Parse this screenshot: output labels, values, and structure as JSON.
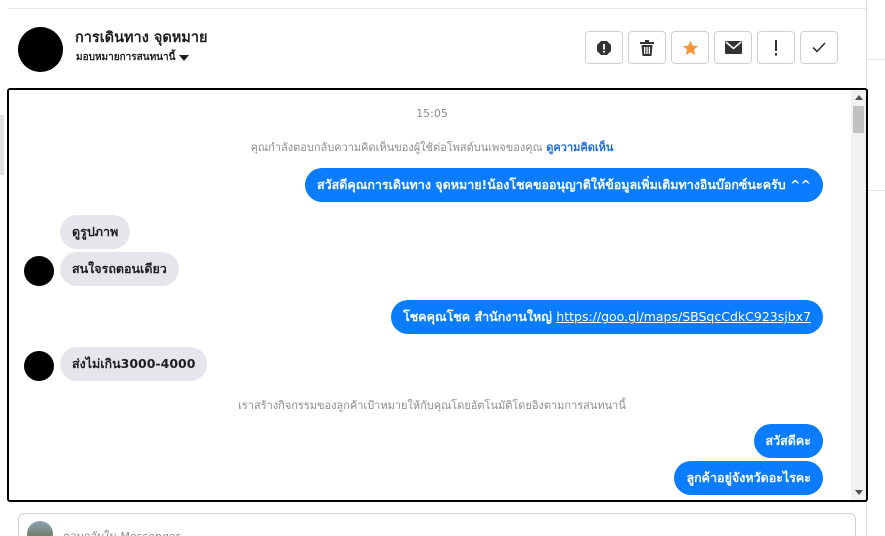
{
  "header": {
    "title": "การเดินทาง จุดหมาย",
    "assign_label": "มอบหมายการสนทนานี้",
    "toolbar": [
      {
        "name": "spam-button",
        "icon": "alert-icon"
      },
      {
        "name": "delete-button",
        "icon": "trash-icon"
      },
      {
        "name": "follow-up-button",
        "icon": "star-icon"
      },
      {
        "name": "mark-unread-button",
        "icon": "envelope-icon"
      },
      {
        "name": "important-button",
        "icon": "exclamation-icon"
      },
      {
        "name": "done-button",
        "icon": "check-icon"
      }
    ]
  },
  "conversation": {
    "timestamp": "15:05",
    "reply_note": "คุณกำลังตอบกลับความคิดเห็นของผู้ใช้ต่อโพสต์บนเพจของคุณ",
    "reply_note_link": "ดูความคิดเห็น",
    "messages": [
      {
        "side": "out",
        "text": "สวัสดีคุณการเดินทาง จุดหมาย!น้องโชคขออนุญาติให้ข้อมูลเพิ่มเติมทางอินบ๊อกซ์นะครับ ^^"
      },
      {
        "side": "in",
        "text": "ดูรูปภาพ"
      },
      {
        "side": "in",
        "text": "สนใจรถตอนเดียว"
      },
      {
        "side": "out",
        "text_prefix": "โชคคุณโชค สำนักงานใหญ่ ",
        "link": "https://goo.gl/maps/SBSqcCdkC923sjbx7"
      },
      {
        "side": "in",
        "text": "ส่งไม่เกิน3000-4000"
      },
      {
        "side": "out",
        "text": "สวัสดีคะ"
      },
      {
        "side": "out",
        "text": "ลูกค้าอยู่จังหวัดอะไรคะ"
      }
    ],
    "system_note": "เราสร้างกิจกรรมของลูกค้าเป้าหมายให้กับคุณโดยอัตโนมัติโดยอิงตามการสนทนานี้"
  },
  "composer": {
    "placeholder": "ตอบกลับใน Messenger"
  },
  "colors": {
    "outgoing_bubble": "#0a7cff",
    "incoming_bubble": "#e4e6eb",
    "star_accent": "#f5933b",
    "link": "#216fdb"
  }
}
